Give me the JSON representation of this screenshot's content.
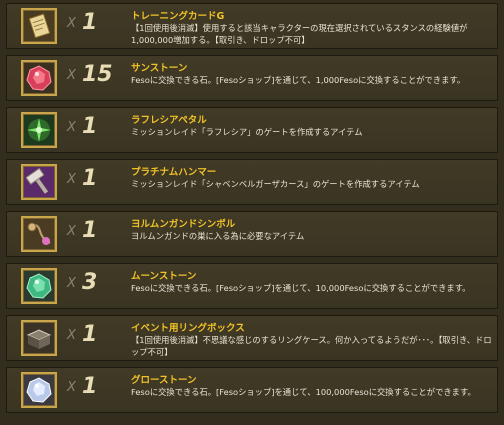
{
  "items": [
    {
      "quantity": "1",
      "name": "トレーニングカードG",
      "desc": "【1回使用後消滅】使用すると該当キャラクターの現在選択されているスタンスの経験値が1,000,000増加する。【取引き、ドロップ不可】",
      "icon": "training-card-icon"
    },
    {
      "quantity": "15",
      "name": "サンストーン",
      "desc": "Fesoに交換できる石。[Fesoショップ]を通じて、1,000Fesoに交換することができます。",
      "icon": "sun-stone-icon"
    },
    {
      "quantity": "1",
      "name": "ラフレシアペタル",
      "desc": "ミッションレイド「ラフレシア」のゲートを作成するアイテム",
      "icon": "rafflesia-petal-icon"
    },
    {
      "quantity": "1",
      "name": "プラチナムハンマー",
      "desc": "ミッションレイド「シャベンベルガーザカース」のゲートを作成するアイテム",
      "icon": "platinum-hammer-icon"
    },
    {
      "quantity": "1",
      "name": "ヨルムンガンドシンボル",
      "desc": "ヨルムンガンドの巣に入る為に必要なアイテム",
      "icon": "jormungand-symbol-icon"
    },
    {
      "quantity": "3",
      "name": "ムーンストーン",
      "desc": "Fesoに交換できる石。[Fesoショップ]を通じて、10,000Fesoに交換することができます。",
      "icon": "moon-stone-icon"
    },
    {
      "quantity": "1",
      "name": "イベント用リングボックス",
      "desc": "【1回使用後消滅】不思議な感じのするリングケース。何か入ってるようだが･･･。【取引き、ドロップ不可】",
      "icon": "ring-box-icon"
    },
    {
      "quantity": "1",
      "name": "グローストーン",
      "desc": "Fesoに交換できる石。[Fesoショップ]を通じて、100,000Fesoに交換することができます。",
      "icon": "glow-stone-icon"
    }
  ],
  "multiplier_symbol": "X"
}
